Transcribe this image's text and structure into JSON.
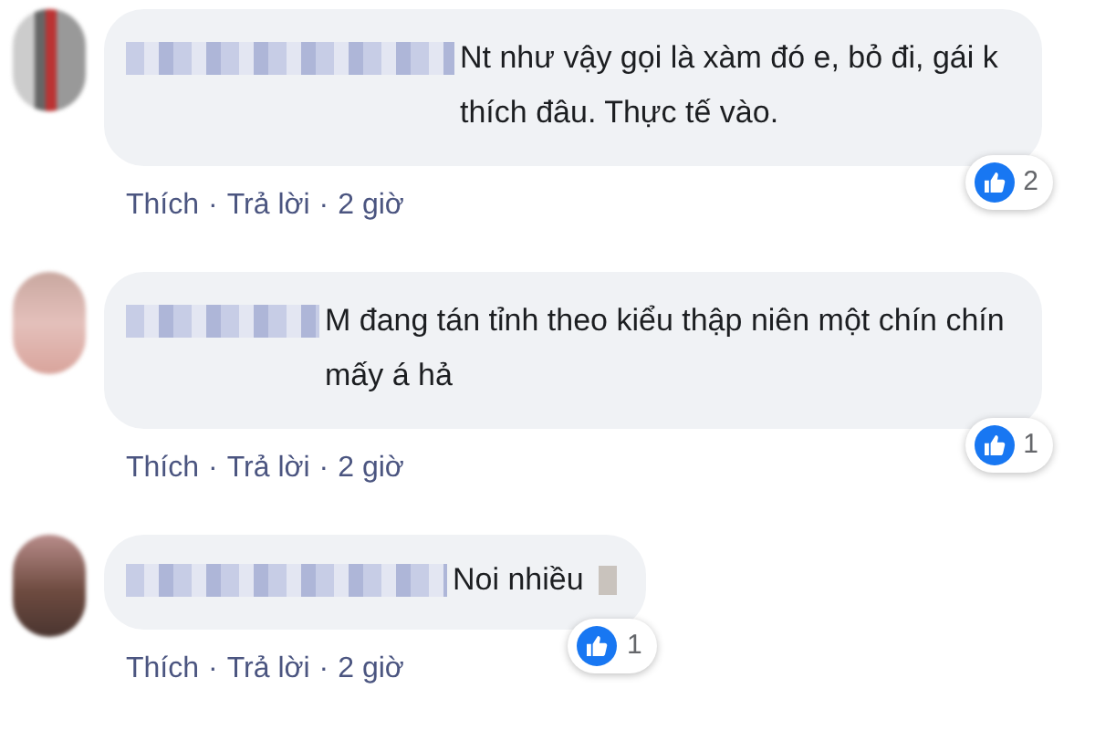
{
  "separator": "·",
  "comments": [
    {
      "text": "Nt như vậy gọi là xàm đó e, bỏ đi, gái k thích đâu. Thực tế vào.",
      "reactions": "2",
      "actions": [
        "Thích",
        "Trả lời"
      ],
      "time": "2 giờ"
    },
    {
      "text": "M đang tán tỉnh theo kiểu thập niên một chín chín mấy á hả",
      "reactions": "1",
      "actions": [
        "Thích",
        "Trả lời"
      ],
      "time": "2 giờ"
    },
    {
      "text": "Noi nhiều",
      "reactions": "1",
      "actions": [
        "Thích",
        "Trả lời"
      ],
      "time": "2 giờ"
    }
  ]
}
